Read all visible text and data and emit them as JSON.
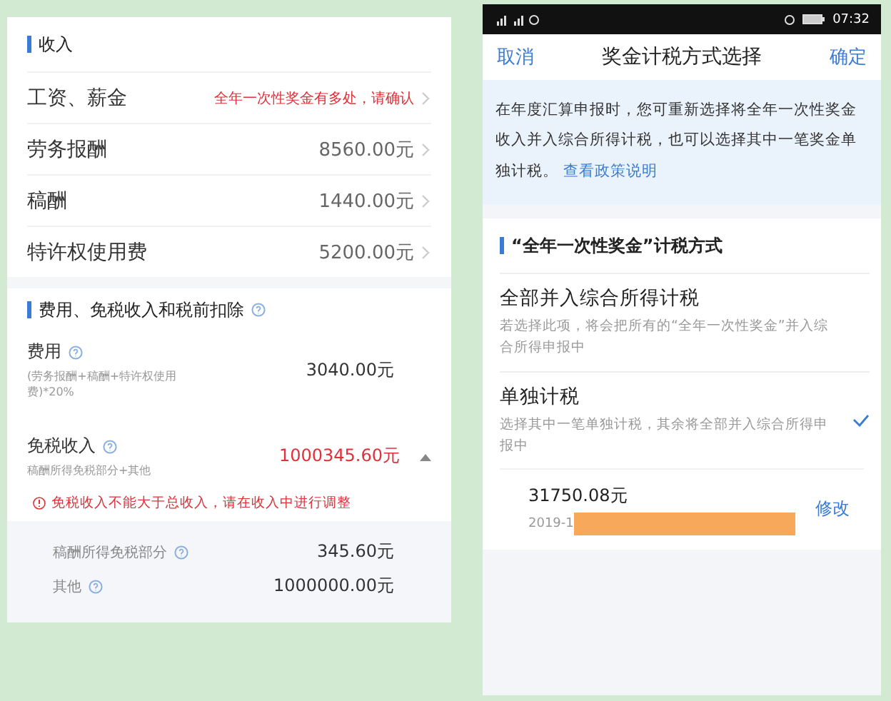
{
  "left": {
    "income": {
      "title": "收入",
      "rows": [
        {
          "label": "工资、薪金",
          "value": "全年一次性奖金有多处，请确认",
          "kind": "warning"
        },
        {
          "label": "劳务报酬",
          "value": "8560.00元",
          "kind": "amount"
        },
        {
          "label": "稿酬",
          "value": "1440.00元",
          "kind": "amount"
        },
        {
          "label": "特许权使用费",
          "value": "5200.00元",
          "kind": "amount"
        }
      ]
    },
    "deductions": {
      "title": "费用、免税收入和税前扣除",
      "fees": {
        "label": "费用",
        "note": "(劳务报酬+稿酬+特许权使用费)*20%",
        "value": "3040.00元"
      },
      "exempt": {
        "label": "免税收入",
        "note": "稿酬所得免税部分+其他",
        "value": "1000345.60元",
        "expanded": true
      },
      "error": "免税收入不能大于总收入，请在收入中进行调整",
      "sub_items": [
        {
          "label": "稿酬所得免税部分",
          "value": "345.60元"
        },
        {
          "label": "其他",
          "value": "1000000.00元"
        }
      ]
    }
  },
  "right": {
    "status_bar": {
      "time": "07:32"
    },
    "nav": {
      "cancel": "取消",
      "title": "奖金计税方式选择",
      "confirm": "确定"
    },
    "notice": {
      "text": "在年度汇算申报时，您可重新选择将全年一次性奖金收入并入综合所得计税，也可以选择其中一笔奖金单独计税。",
      "link": "查看政策说明"
    },
    "section_title": "“全年一次性奖金”计税方式",
    "options": [
      {
        "title": "全部并入综合所得计税",
        "description": "若选择此项，将会把所有的“全年一次性奖金”并入综合所得申报中",
        "selected": false
      },
      {
        "title": "单独计税",
        "description": "选择其中一笔单独计税，其余将全部并入综合所得申报中",
        "selected": true
      }
    ],
    "bonus": {
      "amount": "31750.08元",
      "date": "2019-1",
      "edit": "修改"
    }
  }
}
